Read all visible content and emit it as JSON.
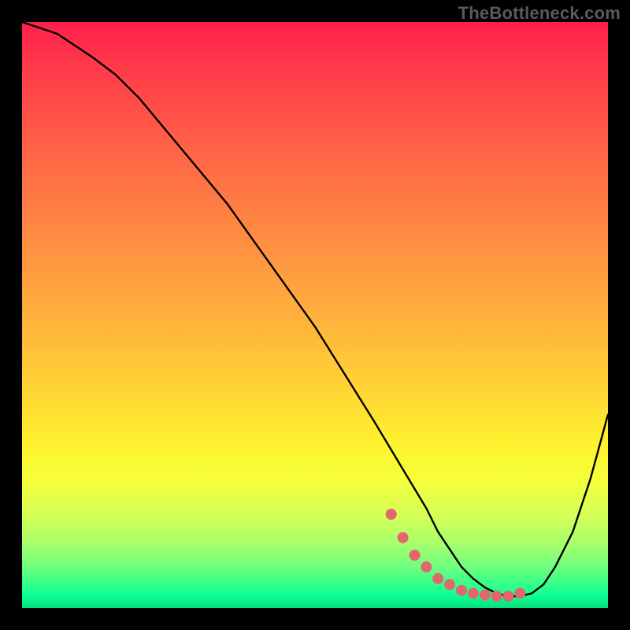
{
  "watermark": "TheBottleneck.com",
  "chart_data": {
    "type": "line",
    "title": "",
    "xlabel": "",
    "ylabel": "",
    "xlim": [
      0,
      100
    ],
    "ylim": [
      0,
      100
    ],
    "grid": false,
    "series": [
      {
        "name": "bottleneck-curve",
        "x": [
          0,
          3,
          6,
          9,
          12,
          16,
          20,
          25,
          30,
          35,
          40,
          45,
          50,
          55,
          60,
          63,
          66,
          69,
          71,
          73,
          75,
          77,
          79,
          81,
          83,
          85,
          87,
          89,
          91,
          94,
          97,
          100
        ],
        "values": [
          100,
          99,
          98,
          96,
          94,
          91,
          87,
          81,
          75,
          69,
          62,
          55,
          48,
          40,
          32,
          27,
          22,
          17,
          13,
          10,
          7,
          5,
          3.5,
          2.5,
          2,
          2,
          2.5,
          4,
          7,
          13,
          22,
          33
        ]
      },
      {
        "name": "markers",
        "x": [
          63,
          65,
          67,
          69,
          71,
          73,
          75,
          77,
          79,
          81,
          83,
          85
        ],
        "values": [
          16,
          12,
          9,
          7,
          5,
          4,
          3,
          2.5,
          2.2,
          2,
          2,
          2.5
        ]
      }
    ]
  }
}
